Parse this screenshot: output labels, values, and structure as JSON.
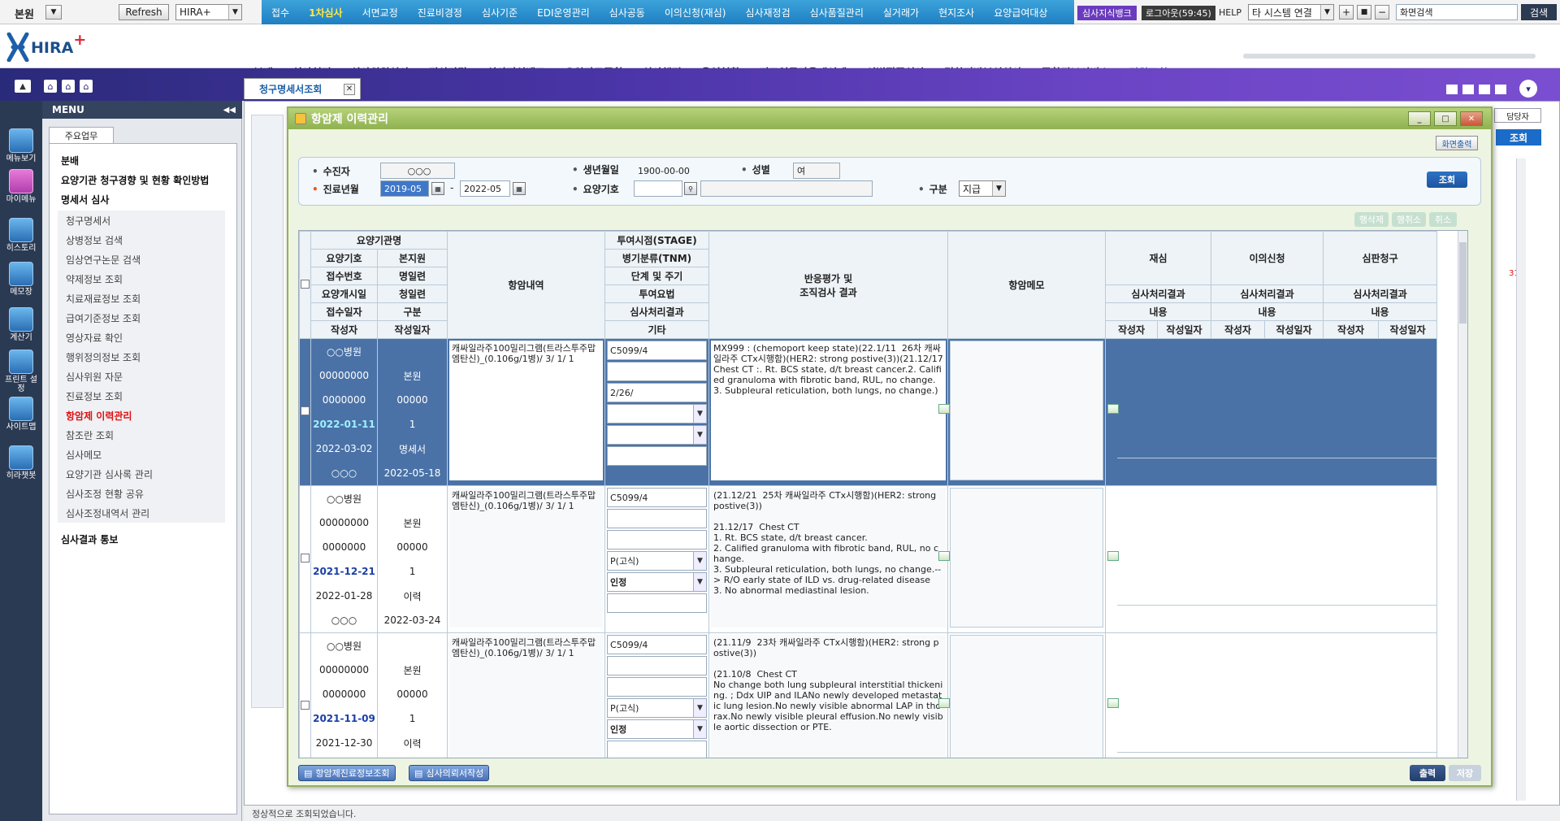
{
  "topbar": {
    "site": "본원",
    "refresh": "Refresh",
    "system_select": "HIRA+",
    "nav": [
      "접수",
      "1차심사",
      "서면교정",
      "진료비경정",
      "심사기준",
      "EDI운영관리",
      "심사공동",
      "이의신청(재심)",
      "심사재정검",
      "심사품질관리",
      "실거래가",
      "현지조사",
      "요양급여대상"
    ],
    "active_nav": "1차심사",
    "knowledge_bank": "심사지식뱅크",
    "logout": "로그아웃(59:45)",
    "help": "HELP",
    "other_system": "타 시스템 연결",
    "screen_search": "화면검색",
    "search_btn": "검색"
  },
  "logo": {
    "text": "HIRA",
    "plus": "+"
  },
  "main_nav": [
    "분배",
    "심사처리",
    "심사위원심사",
    "전산마감",
    "심사지식뱅크",
    "요양자료종합",
    "심사행정",
    "운영현황",
    "지표연동자율개선제",
    "선별집중심사",
    "경향기반분석심사",
    "종합정보서비스",
    "민원조회"
  ],
  "active_main_nav": "민원조회",
  "iconbar": [
    "메뉴보기",
    "마이메뉴",
    "히스토리",
    "메모장",
    "계산기",
    "프린트 설정",
    "사이트맵",
    "히라챗봇"
  ],
  "menu": {
    "title": "MENU",
    "tab": "주요업무",
    "items_top": [
      "분배",
      "요양기관 청구경향 및 현황 확인방법",
      "명세서 심사"
    ],
    "subitems": [
      "청구명세서",
      "상병정보 검색",
      "임상연구논문 검색",
      "약제정보 조회",
      "치료재료정보 조회",
      "급여기준정보 조회",
      "영상자료 확인",
      "행위정의정보 조회",
      "심사위원 자문",
      "진료정보 조회",
      "항암제 이력관리",
      "참조란 조회",
      "심사메모",
      "요양기관 심사록 관리",
      "심사조정 현황 공유",
      "심사조정내역서 관리"
    ],
    "active_sub": "항암제 이력관리",
    "items_bottom": [
      "심사결과 통보"
    ]
  },
  "page_tab": "청구명세서조회",
  "status": "정상적으로 조회되었습니다.",
  "bg": {
    "assignee": "담당자",
    "query": "조회",
    "red": "31"
  },
  "modal": {
    "title": "항암제 이력관리",
    "print_screen": "화면출력",
    "search": {
      "patient_label": "수진자",
      "patient_value": "○○○",
      "dob_label": "생년월일",
      "dob_value": "1900-00-00",
      "sex_label": "성별",
      "sex_value": "여",
      "period_label": "진료년월",
      "period_from": "2019-05",
      "period_to": "2022-05",
      "inst_label": "요양기호",
      "inst_value": "",
      "type_label": "구분",
      "type_value": "지급",
      "query_btn": "조회"
    },
    "row_btns": [
      "행삭제",
      "행취소",
      "취소"
    ],
    "header": {
      "left_grid": [
        [
          "요양기관명"
        ],
        [
          "요양기호",
          "본지원"
        ],
        [
          "접수번호",
          "명일련"
        ],
        [
          "요양개시일",
          "청일련"
        ],
        [
          "접수일자",
          "구분"
        ],
        [
          "작성자",
          "작성일자"
        ]
      ],
      "anticancer": "항암내역",
      "mid_grid": [
        "투여시점(STAGE)",
        "병기분류(TNM)",
        "단계 및 주기",
        "투여요법",
        "심사처리결과",
        "기타"
      ],
      "response": "반응평가 및\n조직검사 결과",
      "memo": "항암메모",
      "appeals": [
        {
          "title": "재심",
          "result": "심사처리결과",
          "content": "내용",
          "writer": "작성자",
          "date": "작성일자"
        },
        {
          "title": "이의신청",
          "result": "심사처리결과",
          "content": "내용",
          "writer": "작성자",
          "date": "작성일자"
        },
        {
          "title": "심판청구",
          "result": "심사처리결과",
          "content": "내용",
          "writer": "작성자",
          "date": "작성일자"
        }
      ]
    },
    "rows": [
      {
        "inst": "○○병원",
        "code": "00000000",
        "branch": "본원",
        "receipt": "0000000",
        "seq": "00000",
        "start": "2022-01-11",
        "claim": "1",
        "recv": "2022-03-02",
        "kind": "명세서",
        "writer": "○○○",
        "wdate": "2022-05-18",
        "drug": "캐싸일라주100밀리그램(트라스투주맙엠탄신)_(0.106g/1병)/ 3/ 1/ 1",
        "stage": "C5099/4",
        "tnm": "",
        "cycle": "2/26/",
        "method": "",
        "result": "",
        "etc": "",
        "response": "MX999 : (chemoport keep state)(22.1/11  26차 캐싸일라주 CTx시행함)(HER2: strong postive(3))(21.12/17  Chest CT :. Rt. BCS state, d/t breast cancer.2. Calified granuloma with fibrotic band, RUL, no change.3. Subpleural reticulation, both lungs, no change.)",
        "selected": true
      },
      {
        "inst": "○○병원",
        "code": "00000000",
        "branch": "본원",
        "receipt": "0000000",
        "seq": "00000",
        "start": "2021-12-21",
        "claim": "1",
        "recv": "2022-01-28",
        "kind": "이력",
        "writer": "○○○",
        "wdate": "2022-03-24",
        "drug": "캐싸일라주100밀리그램(트라스투주맙엠탄신)_(0.106g/1병)/ 3/ 1/ 1",
        "stage": "C5099/4",
        "tnm": "",
        "cycle": "",
        "method": "P(고식)",
        "result": "인정",
        "etc": "",
        "response": "(21.12/21  25차 캐싸일라주 CTx시행함)(HER2: strong postive(3))\n\n21.12/17  Chest CT\n1. Rt. BCS state, d/t breast cancer.\n2. Calified granuloma with fibrotic band, RUL, no change.\n3. Subpleural reticulation, both lungs, no change.--> R/O early state of ILD vs. drug-related disease\n3. No abnormal mediastinal lesion.",
        "selected": false
      },
      {
        "inst": "○○병원",
        "code": "00000000",
        "branch": "본원",
        "receipt": "0000000",
        "seq": "00000",
        "start": "2021-11-09",
        "claim": "1",
        "recv": "2021-12-30",
        "kind": "이력",
        "writer": "○○○",
        "wdate": "",
        "drug": "캐싸일라주100밀리그램(트라스투주맙엠탄신)_(0.106g/1병)/ 3/ 1/ 1",
        "stage": "C5099/4",
        "tnm": "",
        "cycle": "",
        "method": "P(고식)",
        "result": "인정",
        "etc": "",
        "response": "(21.11/9  23차 캐싸일라주 CTx시행함)(HER2: strong postive(3))\n\n(21.10/8  Chest CT\nNo change both lung subpleural interstitial thickening. ; Ddx UIP and ILANo newly developed metastatic lung lesion.No newly visible abnormal LAP in thorax.No newly visible pleural effusion.No newly visible aortic dissection or PTE.",
        "selected": false
      }
    ],
    "bottom": {
      "btn1": "항암제진료정보조회",
      "btn2": "심사의뢰서작성",
      "print": "출력",
      "save": "저장"
    }
  }
}
